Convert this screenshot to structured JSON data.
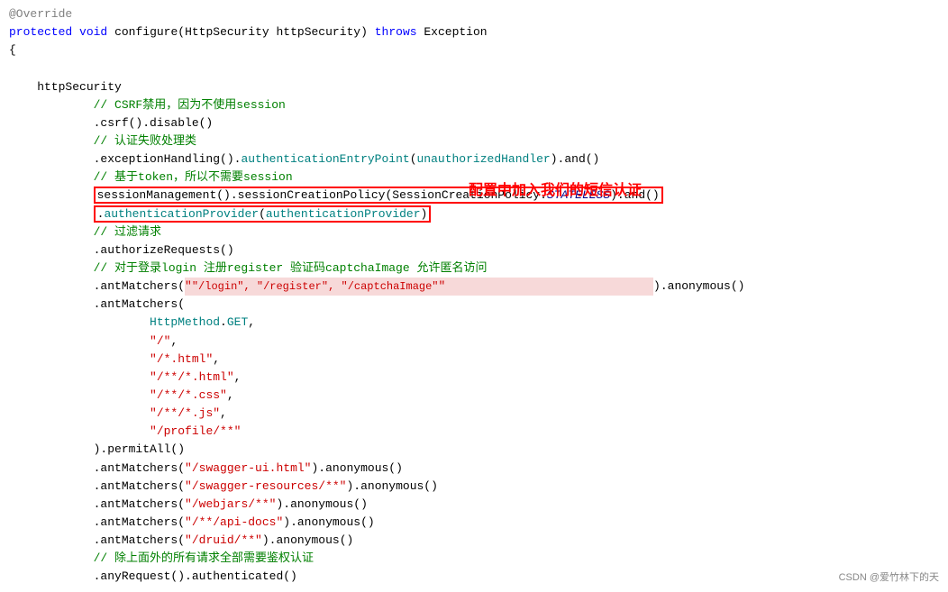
{
  "code": {
    "lines": [
      {
        "id": "l1",
        "type": "annotation-override"
      },
      {
        "id": "l2",
        "type": "method-sig"
      },
      {
        "id": "l3",
        "type": "brace-open"
      },
      {
        "id": "l4",
        "type": "blank"
      },
      {
        "id": "l5",
        "type": "indent1",
        "text": "    httpSecurity"
      },
      {
        "id": "l6",
        "type": "comment",
        "text": "            // CSRF禁用，因为不使用session"
      },
      {
        "id": "l7",
        "type": "code",
        "text": "            .csrf().disable()"
      },
      {
        "id": "l8",
        "type": "comment",
        "text": "            // 认证失败处理类"
      },
      {
        "id": "l9",
        "type": "code",
        "text": "            .exceptionHandling().authenticationEntryPoint(unauthorizedHandler).and()"
      },
      {
        "id": "l10",
        "type": "comment",
        "text": "            // 基于token，所以不需要session"
      },
      {
        "id": "l11",
        "type": "code-box1",
        "text": "            sessionManagement().sessionCreationPolicy(SessionCreationPolicy.STATELESS).and()"
      },
      {
        "id": "l12",
        "type": "code-box2",
        "text": "            .authenticationProvider(authenticationProvider)"
      },
      {
        "id": "l13",
        "type": "comment",
        "text": "            // 过滤请求"
      },
      {
        "id": "l14",
        "type": "code",
        "text": "            .authorizeRequests()"
      },
      {
        "id": "l15",
        "type": "comment",
        "text": "            // 对于登录login 注册register 验证码captchaImage 允许匿名访问"
      },
      {
        "id": "l16",
        "type": "code-antM1"
      },
      {
        "id": "l17",
        "type": "code",
        "text": "            .antMatchers("
      },
      {
        "id": "l18",
        "type": "code",
        "text": "                    HttpMethod.GET,"
      },
      {
        "id": "l19",
        "type": "str",
        "text": "                    \"/\","
      },
      {
        "id": "l20",
        "type": "str",
        "text": "                    \"/*.html\","
      },
      {
        "id": "l21",
        "type": "str",
        "text": "                    \"/**/*.html\","
      },
      {
        "id": "l22",
        "type": "str",
        "text": "                    \"/**/*.css\","
      },
      {
        "id": "l23",
        "type": "str",
        "text": "                    \"/**/*.js\","
      },
      {
        "id": "l24",
        "type": "str",
        "text": "                    \"/profile/**\""
      },
      {
        "id": "l25",
        "type": "code",
        "text": "            ).permitAll()"
      },
      {
        "id": "l26",
        "type": "code",
        "text": "            .antMatchers(\"/swagger-ui.html\").anonymous()"
      },
      {
        "id": "l27",
        "type": "code",
        "text": "            .antMatchers(\"/swagger-resources/**\").anonymous()"
      },
      {
        "id": "l28",
        "type": "code",
        "text": "            .antMatchers(\"/webjars/**\").anonymous()"
      },
      {
        "id": "l29",
        "type": "code",
        "text": "            .antMatchers(\"/**/api-docs\").anonymous()"
      },
      {
        "id": "l30",
        "type": "code",
        "text": "            .antMatchers(\"/druid/**\").anonymous()"
      },
      {
        "id": "l31",
        "type": "comment",
        "text": "            // 除上面外的所有请求全部需要鉴权认证"
      },
      {
        "id": "l32",
        "type": "code",
        "text": "            .anyRequest().authenticated()"
      }
    ],
    "annotation_text": "配置中加入我们的短信认证",
    "watermark": "CSDN @爱竹林下的天"
  }
}
